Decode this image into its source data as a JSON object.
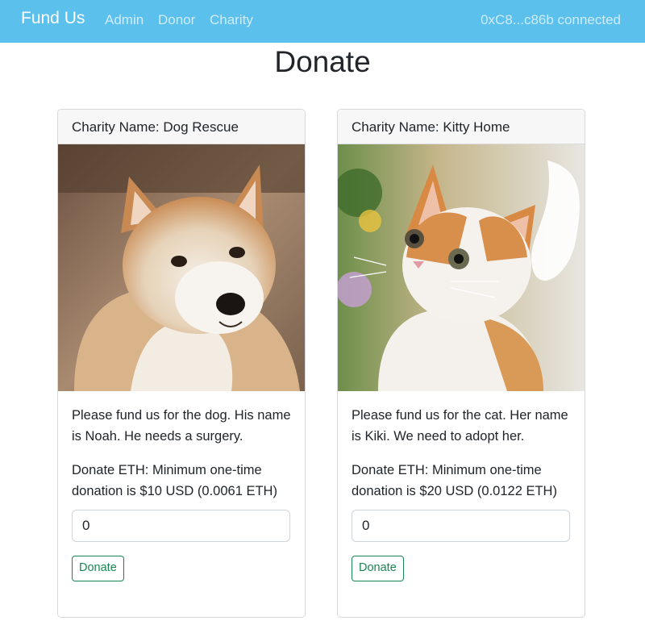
{
  "navbar": {
    "brand": "Fund Us",
    "links": [
      "Admin",
      "Donor",
      "Charity"
    ],
    "account": "0xC8...c86b connected"
  },
  "page": {
    "title": "Donate"
  },
  "cards": [
    {
      "header": "Charity Name: Dog Rescue",
      "image": "shiba-inu-dog-photo",
      "description": "Please fund us for the dog. His name is Noah. He needs a surgery.",
      "donate_label": "Donate ETH: Minimum one-time donation is $10 USD (0.0061 ETH)",
      "input_value": "0",
      "button": "Donate"
    },
    {
      "header": "Charity Name: Kitty Home",
      "image": "orange-white-kitten-photo",
      "description": "Please fund us for the cat. Her name is Kiki. We need to adopt her.",
      "donate_label": "Donate ETH: Minimum one-time donation is $20 USD (0.0122 ETH)",
      "input_value": "0",
      "button": "Donate"
    }
  ],
  "colors": {
    "navbar": "#5bc0eb",
    "button_outline": "#198754"
  }
}
